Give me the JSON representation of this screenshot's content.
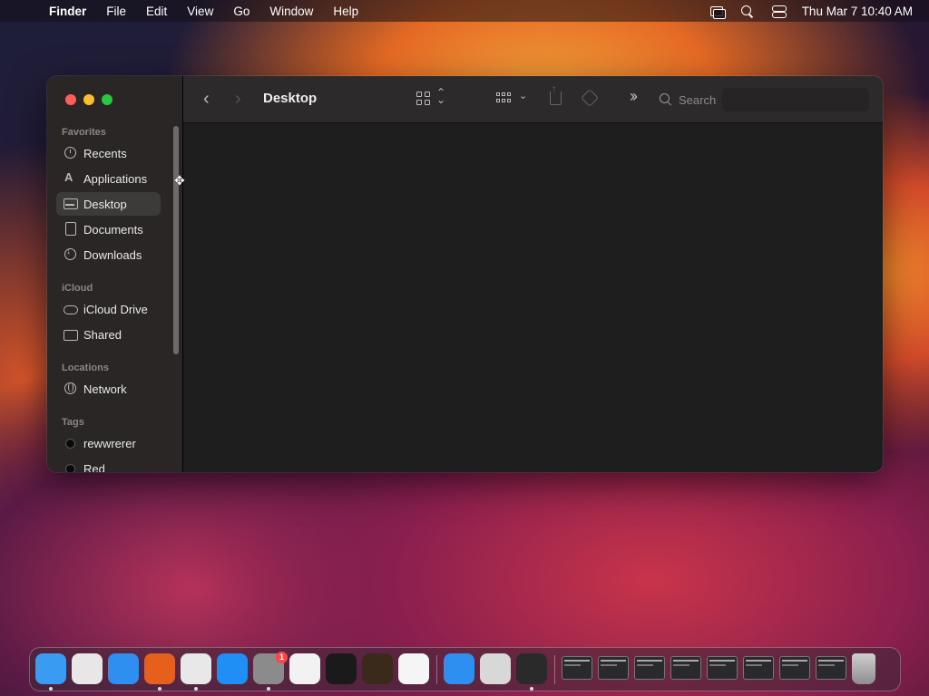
{
  "menubar": {
    "app_name": "Finder",
    "menus": [
      "File",
      "Edit",
      "View",
      "Go",
      "Window",
      "Help"
    ],
    "clock": "Thu Mar 7  10:40 AM"
  },
  "window": {
    "title": "Desktop",
    "search": {
      "placeholder": "Search",
      "value": ""
    }
  },
  "sidebar": {
    "favorites_title": "Favorites",
    "favorites": [
      "Recents",
      "Applications",
      "Desktop",
      "Documents",
      "Downloads"
    ],
    "icloud_title": "iCloud",
    "icloud": [
      "iCloud Drive",
      "Shared"
    ],
    "locations_title": "Locations",
    "locations": [
      "Network"
    ],
    "tags_title": "Tags",
    "tags": [
      "rewwrerer",
      "Red"
    ]
  },
  "dock": {
    "apps": [
      {
        "name": "finder-icon",
        "color": "#3a9bf2",
        "running": true
      },
      {
        "name": "launchpad-icon",
        "color": "#e8e6e6",
        "running": false
      },
      {
        "name": "safari-icon",
        "color": "#2f8ff0",
        "running": false
      },
      {
        "name": "firefox-icon",
        "color": "#e65f1d",
        "running": true
      },
      {
        "name": "chrome-icon",
        "color": "#e8e8e8",
        "running": true
      },
      {
        "name": "app-store-icon",
        "color": "#1f8ff5",
        "running": false
      },
      {
        "name": "system-settings-icon",
        "color": "#8b8b8b",
        "running": true,
        "badge": "1"
      },
      {
        "name": "textedit-icon",
        "color": "#f2f2f2",
        "running": false
      },
      {
        "name": "terminal-icon",
        "color": "#1a1a1a",
        "running": false
      },
      {
        "name": "garageband-icon",
        "color": "#3a2a1a",
        "running": false
      },
      {
        "name": "vscode-icon",
        "color": "#f5f5f5",
        "running": false
      },
      {
        "name": "weather-icon",
        "color": "#2f8ff0",
        "running": false
      },
      {
        "name": "preview-icon",
        "color": "#d8d8d8",
        "running": false
      },
      {
        "name": "parallels-icon",
        "color": "#2a2a2a",
        "running": true
      }
    ],
    "minimized_count": 8,
    "trash": "trash-icon"
  }
}
